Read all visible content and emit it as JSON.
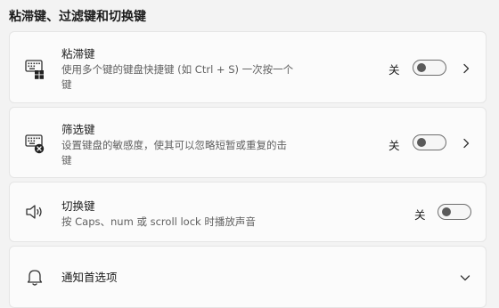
{
  "section_title": "粘滞键、过滤键和切换键",
  "items": [
    {
      "title": "粘滞键",
      "description": "使用多个键的键盘快捷键 (如 Ctrl + S) 一次按一个键",
      "state_label": "关",
      "toggle_on": false,
      "icon": "keyboard-sticky-icon"
    },
    {
      "title": "筛选键",
      "description": "设置键盘的敏感度，使其可以忽略短暂或重复的击键",
      "state_label": "关",
      "toggle_on": false,
      "icon": "keyboard-filter-icon"
    },
    {
      "title": "切换键",
      "description": "按 Caps、num 或 scroll lock 时播放声音",
      "state_label": "关",
      "toggle_on": false,
      "icon": "speaker-icon"
    }
  ],
  "notifications": {
    "title": "通知首选项",
    "icon": "bell-icon"
  },
  "colors": {
    "background": "#f3f3f3",
    "card": "#fbfbfb",
    "border": "#e5e5e5",
    "text": "#1b1b1b",
    "secondary_text": "#5f5f5f"
  }
}
